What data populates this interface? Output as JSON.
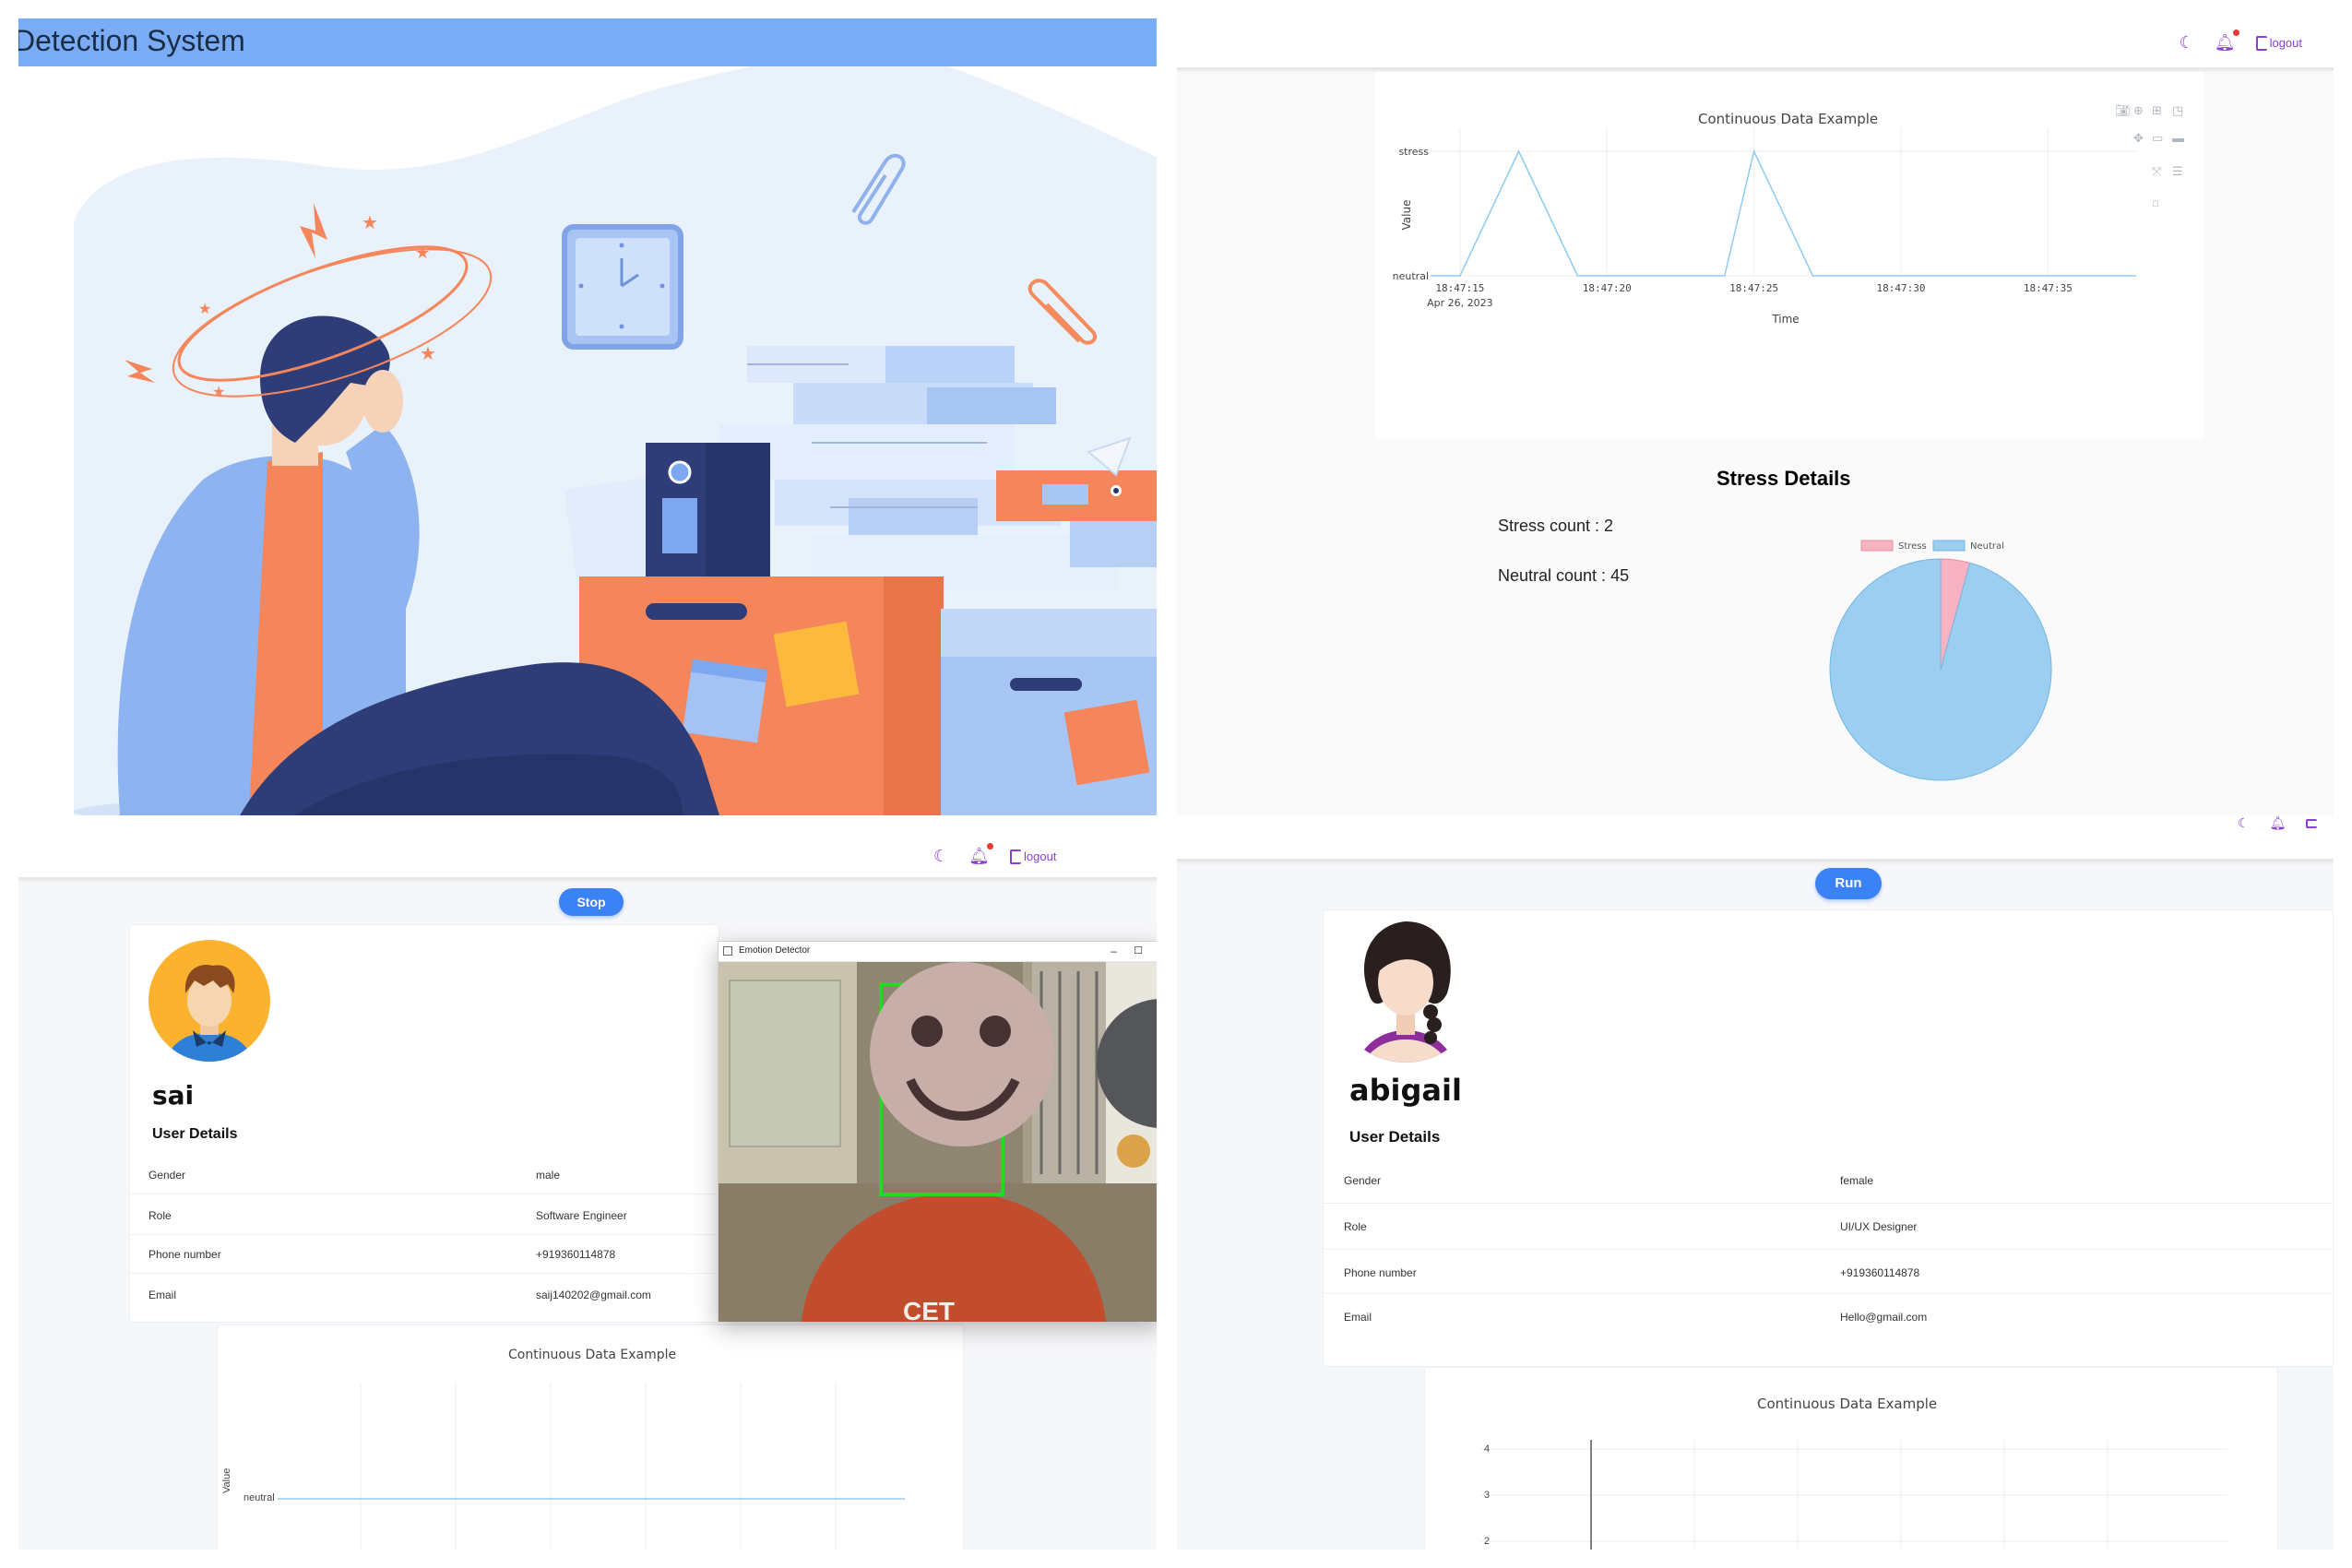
{
  "panel1": {
    "title": "Detection System"
  },
  "nav": {
    "logout_label": "logout"
  },
  "panel2": {
    "line_chart": {
      "title": "Continuous Data Example",
      "ylabel": "Value",
      "xlabel": "Time",
      "y_ticks": [
        "stress",
        "neutral"
      ],
      "x_ticks": [
        "18:47:15",
        "18:47:20",
        "18:47:25",
        "18:47:30",
        "18:47:35"
      ],
      "x_subtick": "Apr 26, 2023",
      "line_color": "#8ecbf2"
    },
    "stress_details": {
      "heading": "Stress Details",
      "stress_count_label": "Stress count : 2",
      "neutral_count_label": "Neutral count : 45"
    },
    "pie": {
      "legend": [
        "Stress",
        "Neutral"
      ],
      "colors": [
        "#f7b3c2",
        "#9ccfef"
      ]
    }
  },
  "panel3": {
    "stop_label": "Stop",
    "user": {
      "name": "sai",
      "details_heading": "User Details",
      "rows": [
        {
          "label": "Gender",
          "value": "male"
        },
        {
          "label": "Role",
          "value": "Software Engineer"
        },
        {
          "label": "Phone number",
          "value": "+919360114878"
        },
        {
          "label": "Email",
          "value": "saij140202@gmail.com"
        }
      ]
    },
    "detector_window_title": "Emotion Detector",
    "chart": {
      "title": "Continuous Data Example",
      "ylabel": "Value",
      "y_tick": "neutral"
    }
  },
  "panel4": {
    "run_label": "Run",
    "user": {
      "name": "abigail",
      "details_heading": "User Details",
      "rows": [
        {
          "label": "Gender",
          "value": "female"
        },
        {
          "label": "Role",
          "value": "UI/UX Designer"
        },
        {
          "label": "Phone number",
          "value": "+919360114878"
        },
        {
          "label": "Email",
          "value": "Hello@gmail.com"
        }
      ]
    },
    "chart": {
      "title": "Continuous Data Example",
      "y_ticks": [
        "4",
        "3",
        "2"
      ]
    }
  },
  "chart_data": [
    {
      "type": "line",
      "title": "Continuous Data Example",
      "xlabel": "Time",
      "ylabel": "Value",
      "categories_y": [
        "neutral",
        "stress"
      ],
      "x": [
        "18:47:14",
        "18:47:15",
        "18:47:17",
        "18:47:19",
        "18:47:20",
        "18:47:22",
        "18:47:24",
        "18:47:25",
        "18:47:27",
        "18:47:29",
        "18:47:32",
        "18:47:35",
        "18:47:38"
      ],
      "y": [
        "neutral",
        "neutral",
        "stress",
        "neutral",
        "neutral",
        "neutral",
        "neutral",
        "stress",
        "neutral",
        "neutral",
        "neutral",
        "neutral",
        "neutral"
      ]
    },
    {
      "type": "pie",
      "categories": [
        "Stress",
        "Neutral"
      ],
      "values": [
        2,
        45
      ]
    }
  ]
}
